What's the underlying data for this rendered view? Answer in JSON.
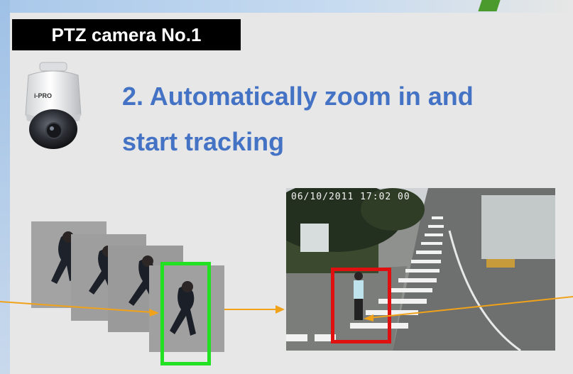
{
  "title_label": "PTZ camera No.1",
  "headline": {
    "line1": "2. Automatically zoom in and",
    "line2": "start tracking"
  },
  "camera": {
    "brand": "i-PRO"
  },
  "video": {
    "timestamp": "06/10/2011 17:02 00"
  },
  "colors": {
    "headline": "#4472c4",
    "tracking_box_sequence": "#22e022",
    "tracking_box_scene": "#e01010",
    "arrow": "#f0a21a",
    "label_bg": "#000000"
  }
}
